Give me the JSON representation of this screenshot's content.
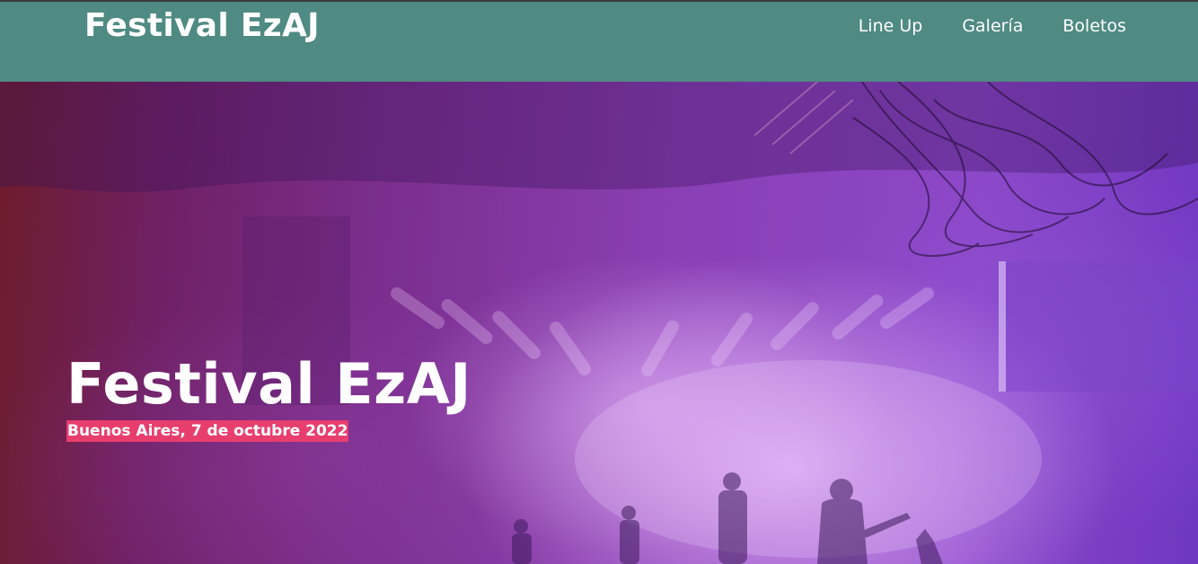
{
  "header": {
    "brand": "Festival EzAJ",
    "nav": [
      {
        "label": "Line Up"
      },
      {
        "label": "Galería"
      },
      {
        "label": "Boletos"
      }
    ]
  },
  "hero": {
    "title": "Festival EzAJ",
    "subtitle": "Buenos Aires, 7 de octubre 2022",
    "background": "concert-stage-photo"
  },
  "colors": {
    "header_bg": "#4f8a83",
    "subtitle_bg": "#e83e6e",
    "text": "#ffffff"
  }
}
